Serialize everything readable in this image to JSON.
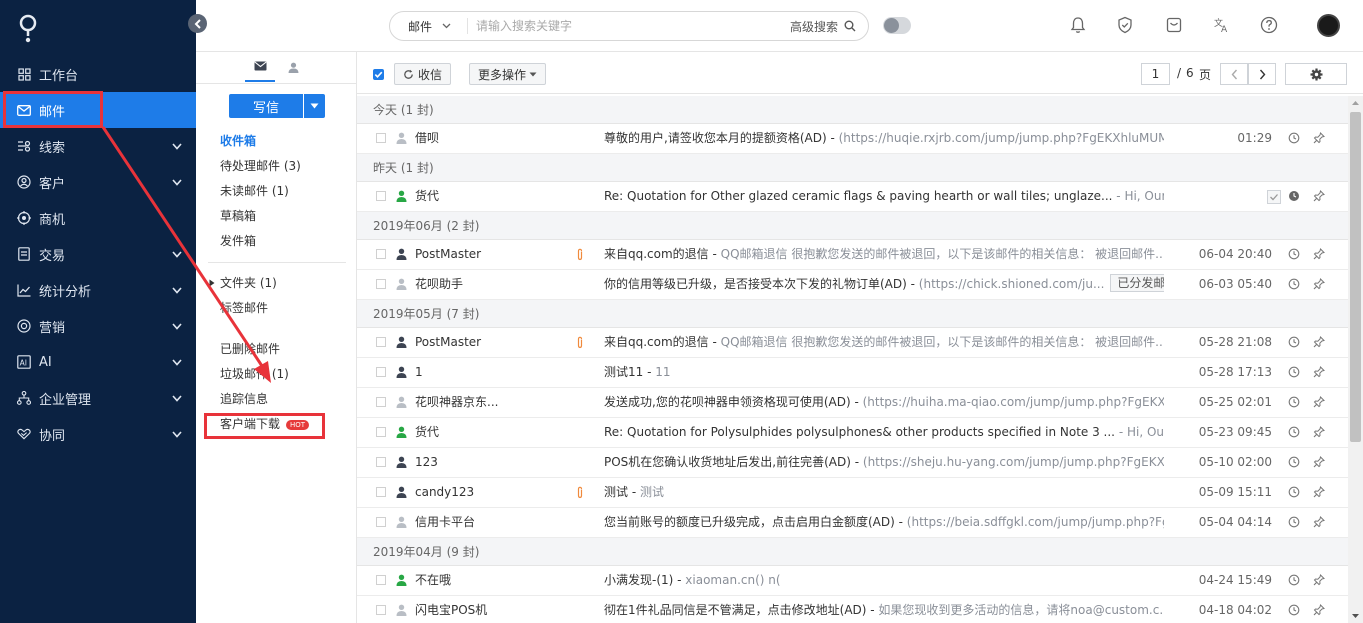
{
  "colors": {
    "sidebar_bg": "#0b2242",
    "accent": "#1e7ce8",
    "annotation": "#e8333a",
    "hot_badge": "#e63b3b",
    "online_icon": "#28a745"
  },
  "sidebar": {
    "items": [
      {
        "label": "工作台",
        "icon": "grid-icon",
        "has_submenu": false
      },
      {
        "label": "邮件",
        "icon": "mail-icon",
        "has_submenu": false,
        "active": true
      },
      {
        "label": "线索",
        "icon": "lead-icon",
        "has_submenu": true
      },
      {
        "label": "客户",
        "icon": "customer-icon",
        "has_submenu": true
      },
      {
        "label": "商机",
        "icon": "target-icon",
        "has_submenu": false
      },
      {
        "label": "交易",
        "icon": "document-icon",
        "has_submenu": true
      },
      {
        "label": "统计分析",
        "icon": "chart-icon",
        "has_submenu": true
      },
      {
        "label": "营销",
        "icon": "marketing-icon",
        "has_submenu": true
      },
      {
        "label": "AI",
        "icon": "ai-icon",
        "has_submenu": true
      },
      {
        "label": "企业管理",
        "icon": "org-icon",
        "has_submenu": true
      },
      {
        "label": "协同",
        "icon": "collab-icon",
        "has_submenu": true
      }
    ]
  },
  "header": {
    "search": {
      "scope": "邮件",
      "placeholder": "请输入搜索关键字",
      "advanced": "高级搜索"
    }
  },
  "folders": {
    "compose": "写信",
    "items": [
      {
        "label": "收件箱",
        "active": true
      },
      {
        "label": "待处理邮件 (3)"
      },
      {
        "label": "未读邮件 (1)"
      },
      {
        "label": "草稿箱"
      },
      {
        "label": "发件箱"
      }
    ],
    "folder_group": "文件夹 (1)",
    "tagged": "标签邮件",
    "items2": [
      {
        "label": "已删除邮件"
      },
      {
        "label": "垃圾邮件 (1)"
      },
      {
        "label": "追踪信息"
      }
    ],
    "client_download": "客户端下载",
    "hot_label": "HOT"
  },
  "toolbar": {
    "receive": "收信",
    "more": "更多操作",
    "page_current": "1",
    "page_sep": "/",
    "page_total": "6",
    "page_unit": "页"
  },
  "groups": [
    {
      "label": "今天 (1 封)",
      "rows": [
        {
          "sender": "借呗",
          "subject": "尊敬的用户,请签收您本月的提额资格(AD) - ",
          "preview": " (https://huqie.rxjrb.com/jump/jump.php?FgEKXhluMUMFKz...",
          "time": "01:29",
          "person": "gray",
          "clip": false
        }
      ]
    },
    {
      "label": "昨天 (1 封)",
      "rows": [
        {
          "sender": "货代",
          "subject": "Re: Quotation for Other glazed ceramic flags & paving hearth or wall tiles; unglaze...",
          "preview": "  -  Hi, Our compa...",
          "time": "",
          "person": "green",
          "clip": false,
          "done": true
        }
      ]
    },
    {
      "label": "2019年06月 (2 封)",
      "rows": [
        {
          "sender": "PostMaster",
          "subject": "来自qq.com的退信 - ",
          "preview": " QQ邮箱退信 很抱歉您发送的邮件被退回，以下是该邮件的相关信息：  被退回邮件...",
          "time": "06-04 20:40",
          "person": "dark",
          "clip": true
        },
        {
          "sender": "花呗助手",
          "subject": "你的信用等级已升级，是否接受本次下发的礼物订单(AD) - ",
          "preview": " (https://chick.shioned.com/ju...",
          "tag": "已分发邮件",
          "time": "06-03 05:40",
          "person": "gray",
          "clip": false
        }
      ]
    },
    {
      "label": "2019年05月 (7 封)",
      "rows": [
        {
          "sender": "PostMaster",
          "subject": "来自qq.com的退信 - ",
          "preview": " QQ邮箱退信 很抱歉您发送的邮件被退回，以下是该邮件的相关信息：  被退回邮件...",
          "time": "05-28 21:08",
          "person": "dark",
          "clip": true
        },
        {
          "sender": "1",
          "subject": "测试11 - ",
          "preview": "  11",
          "time": "05-28 17:13",
          "person": "dark",
          "clip": false
        },
        {
          "sender": "花呗神器京东...",
          "subject": "发送成功,您的花呗神器申领资格现可使用(AD) - ",
          "preview": " (https://huiha.ma-qiao.com/jump/jump.php?FgEKXhlu...",
          "time": "05-25 02:01",
          "person": "gray",
          "clip": false
        },
        {
          "sender": "货代",
          "subject": "Re: Quotation for Polysulphides polysulphones& other products specified in Note 3 ...",
          "preview": "  -  Hi, Our compa...",
          "time": "05-23 09:45",
          "person": "green",
          "clip": false
        },
        {
          "sender": "123",
          "subject": "POS机在您确认收货地址后发出,前往完善(AD) - ",
          "preview": " (https://sheju.hu-yang.com/jump/jump.php?FgEKXhlu...",
          "time": "05-10 02:00",
          "person": "dark",
          "clip": false
        },
        {
          "sender": "candy123",
          "subject": "测试 - ",
          "preview": "      测试",
          "time": "05-09 15:11",
          "person": "dark",
          "clip": true
        },
        {
          "sender": "信用卡平台",
          "subject": "您当前账号的额度已升级完成，点击启用白金额度(AD) - ",
          "preview": " (https://beia.sdffgkl.com/jump/jump.php?FgEK...",
          "time": "05-04 04:14",
          "person": "gray",
          "clip": false
        }
      ]
    },
    {
      "label": "2019年04月 (9 封)",
      "rows": [
        {
          "sender": "不在哦",
          "subject": "小满发现-(1) - ",
          "preview": "        xiaoman.cn()                                              n(",
          "time": "04-24 15:49",
          "person": "green",
          "clip": false
        },
        {
          "sender": "闪电宝POS机",
          "subject": "彻在1件礼品同信是不管满足，点击修改地址(AD) - ",
          "preview": " 如果您现收到更多活动的信息，请将noa@custom.c...",
          "time": "04-18 04:02",
          "person": "gray",
          "clip": false
        }
      ]
    }
  ]
}
